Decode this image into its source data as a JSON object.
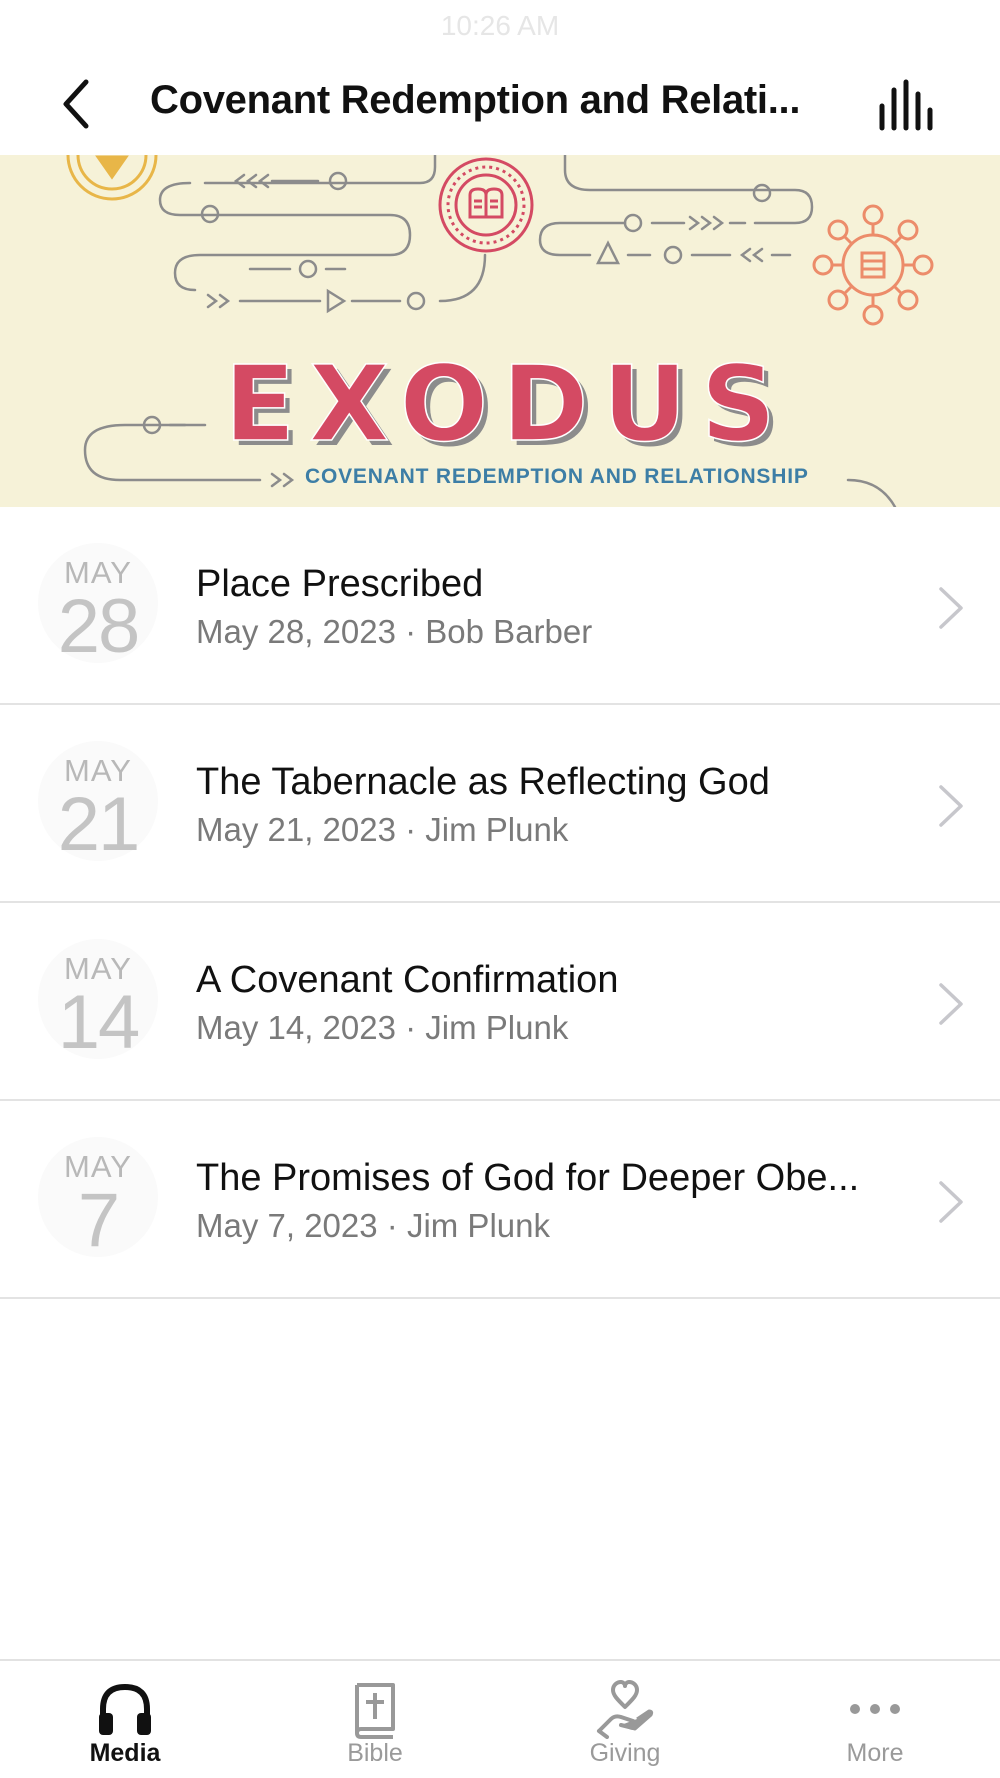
{
  "status_bar": {
    "time": "10:26 AM"
  },
  "nav": {
    "title": "Covenant Redemption and Relati...",
    "back_icon": "chevron-left-icon",
    "audio_icon": "audio-bars-icon"
  },
  "banner": {
    "title": "EXODUS",
    "subtitle": "COVENANT REDEMPTION AND RELATIONSHIP",
    "colors": {
      "background": "#f6f2d8",
      "title": "#d44a63",
      "subtitle": "#3d7ea6",
      "lines": "#8c8c8c"
    }
  },
  "sermons": [
    {
      "month": "MAY",
      "day": "28",
      "title": "Place Prescribed",
      "subtitle": "May 28, 2023 · Bob Barber"
    },
    {
      "month": "MAY",
      "day": "21",
      "title": "The Tabernacle as Reflecting God",
      "subtitle": "May 21, 2023 · Jim Plunk"
    },
    {
      "month": "MAY",
      "day": "14",
      "title": "A Covenant Confirmation",
      "subtitle": "May 14, 2023 · Jim Plunk"
    },
    {
      "month": "MAY",
      "day": "7",
      "title": "The Promises of God for Deeper Obe...",
      "subtitle": "May 7, 2023 · Jim Plunk"
    }
  ],
  "tabs": [
    {
      "label": "Media",
      "icon": "headphones-icon",
      "active": true
    },
    {
      "label": "Bible",
      "icon": "bible-icon",
      "active": false
    },
    {
      "label": "Giving",
      "icon": "giving-hand-icon",
      "active": false
    },
    {
      "label": "More",
      "icon": "more-dots-icon",
      "active": false
    }
  ]
}
